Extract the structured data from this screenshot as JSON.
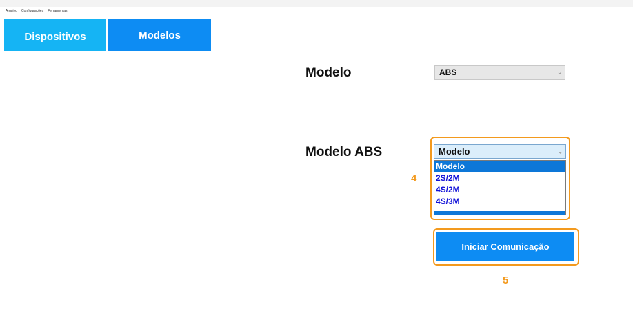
{
  "menubar": {
    "items": [
      "Arquivo",
      "Configurações",
      "Ferramentas"
    ]
  },
  "tabs": [
    {
      "label": "Dispositivos"
    },
    {
      "label": "Modelos"
    }
  ],
  "form": {
    "modelo_label": "Modelo",
    "modelo_value": "ABS",
    "modelo_abs_label": "Modelo ABS",
    "modelo_abs_value": "Modelo",
    "modelo_abs_options": [
      "Modelo",
      "2S/2M",
      "4S/2M",
      "4S/3M"
    ],
    "selected_option": "Modelo"
  },
  "start_button": {
    "label": "Iniciar Comunicação"
  },
  "annotations": {
    "step_dropdown": "4",
    "step_button": "5"
  },
  "colors": {
    "tab_primary": "#15b4f4",
    "tab_secondary": "#0d8cf3",
    "highlight": "#f39a1e",
    "option_text": "#1010d8"
  }
}
